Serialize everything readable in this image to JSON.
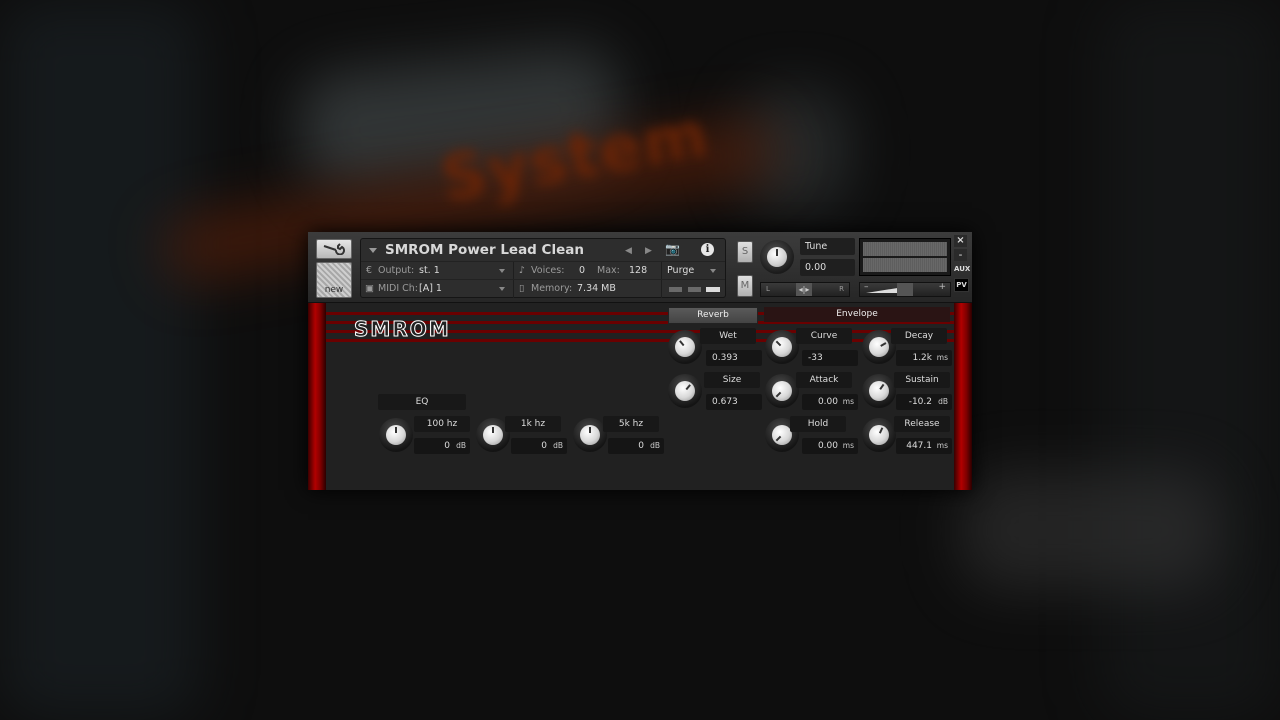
{
  "background": {
    "blurred_text": "System"
  },
  "header": {
    "instrument_name": "SMROM Power Lead Clean",
    "output_label": "Output:",
    "output_value": "st. 1",
    "midi_label": "MIDI Ch:",
    "midi_value": "[A]  1",
    "voices_label": "Voices:",
    "voices_value": "0",
    "max_label": "Max:",
    "max_value": "128",
    "memory_label": "Memory:",
    "memory_value": "7.34 MB",
    "purge_label": "Purge",
    "new_label": "new",
    "solo_label": "S",
    "mute_label": "M",
    "tune_label": "Tune",
    "tune_value": "0.00",
    "pan_left": "L",
    "pan_right": "R",
    "vol_minus": "–",
    "vol_plus": "+",
    "close_label": "×",
    "minimize_label": "–",
    "aux_label": "AUX",
    "pv_label": "PV"
  },
  "panel": {
    "logo": "SMROM",
    "tabs": {
      "reverb": "Reverb",
      "envelope": "Envelope"
    },
    "reverb": {
      "wet": {
        "label": "Wet",
        "value": "0.393"
      },
      "size": {
        "label": "Size",
        "value": "0.673"
      }
    },
    "envelope": {
      "curve": {
        "label": "Curve",
        "value": "-33"
      },
      "attack": {
        "label": "Attack",
        "value": "0.00",
        "unit": "ms"
      },
      "hold": {
        "label": "Hold",
        "value": "0.00",
        "unit": "ms"
      },
      "decay": {
        "label": "Decay",
        "value": "1.2k",
        "unit": "ms"
      },
      "sustain": {
        "label": "Sustain",
        "value": "-10.2",
        "unit": "dB"
      },
      "release": {
        "label": "Release",
        "value": "447.1",
        "unit": "ms"
      }
    },
    "eq": {
      "label": "EQ",
      "bands": [
        {
          "label": "100 hz",
          "value": "0",
          "unit": "dB"
        },
        {
          "label": "1k hz",
          "value": "0",
          "unit": "dB"
        },
        {
          "label": "5k hz",
          "value": "0",
          "unit": "dB"
        }
      ]
    }
  }
}
